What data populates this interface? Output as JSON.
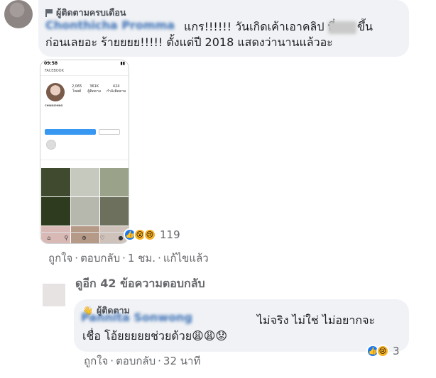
{
  "comment": {
    "badge": "ผู้ติดตามครบเดือน",
    "author": "Chonthicha Promma",
    "text_line1_a": "แกร!!!!!! วันเกิดเค้าเอาคลิป พี่",
    "text_line1_b": "ขึ้น",
    "text_line2": "ก่อนเลยอะ ร้ายยยย!!!!! ตั้งแต่ปี 2018 แสดงว่านานแล้วอะ",
    "reaction_count": "119",
    "actions": [
      "ถูกใจ",
      "ตอบกลับ",
      "1 ชม.",
      "แก้ไขแล้ว"
    ],
    "more_replies": "ดูอีก 42 ข้อความตอบกลับ"
  },
  "reply": {
    "badge": "ผู้ติดตาม",
    "author": "Pannita Sonwong",
    "text_line1": "ไม่จริง ไม่ใช่ ไม่อยากจะ",
    "text_line2": "เชื่อ โอ้ยยยยยช่วยด้วย😩😩😟",
    "reaction_count": "3",
    "actions": [
      "ถูกใจ",
      "ตอบกลับ",
      "32 นาที"
    ]
  },
  "phone": {
    "time": "09:58",
    "app_label": "FACEBOOK",
    "stats": [
      {
        "value": "2,065",
        "label": "โพสต์"
      },
      {
        "value": "361K",
        "label": "ผู้ติดตาม"
      },
      {
        "value": "424",
        "label": "กำลังติดตาม"
      }
    ],
    "username": "CHINGCHING",
    "highlight_label": "HBD2019"
  },
  "colors": {
    "bubble": "#f0f2f5",
    "meta_text": "#65676b",
    "like_blue": "#1877f2",
    "emoji_yellow": "#f7b125"
  }
}
